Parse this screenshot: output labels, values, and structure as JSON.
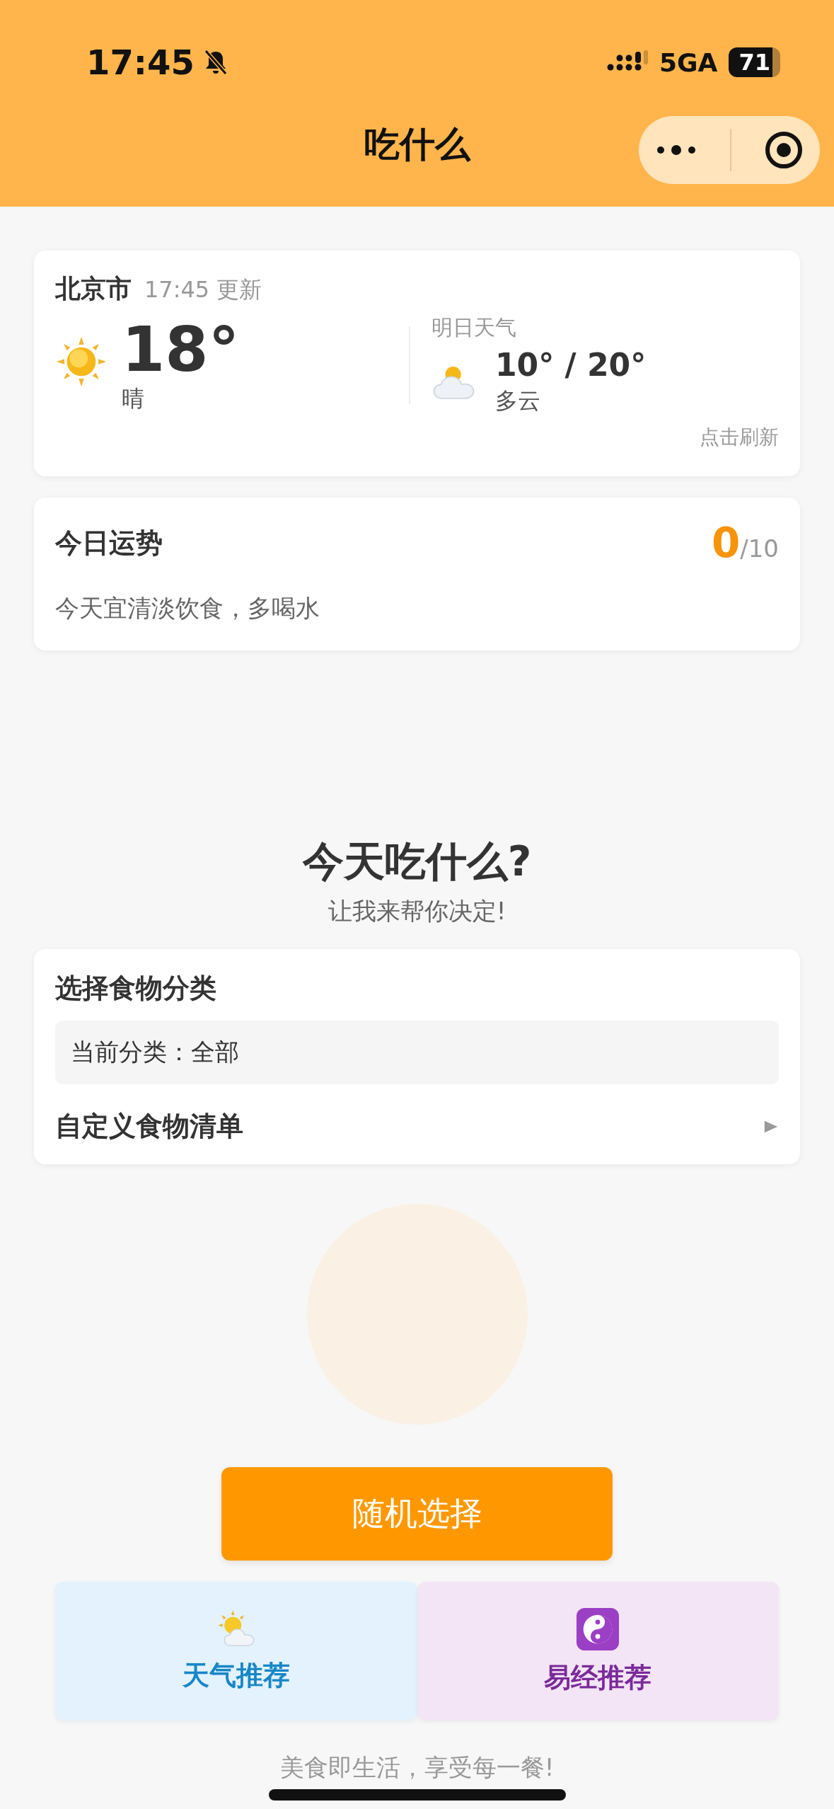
{
  "status_bar": {
    "time": "17:45",
    "network": "5GA",
    "battery": "71"
  },
  "nav": {
    "title": "吃什么"
  },
  "weather": {
    "city": "北京市",
    "updated": "17:45 更新",
    "temp": "18°",
    "condition": "晴",
    "tomorrow_label": "明日天气",
    "tomorrow_temp": "10° / 20°",
    "tomorrow_condition": "多云",
    "refresh": "点击刷新"
  },
  "fortune": {
    "title": "今日运势",
    "score": "0",
    "max": "/10",
    "advice": "今天宜清淡饮食，多喝水"
  },
  "hero": {
    "title": "今天吃什么?",
    "subtitle": "让我来帮你决定!"
  },
  "category": {
    "title": "选择食物分类",
    "current": "当前分类：全部",
    "custom_list": "自定义食物清单"
  },
  "random_button": "随机选择",
  "recommendations": [
    {
      "kind": "weather",
      "label": "天气推荐"
    },
    {
      "kind": "iching",
      "label": "易经推荐"
    }
  ],
  "footer": "美食即生活，享受每一餐!"
}
